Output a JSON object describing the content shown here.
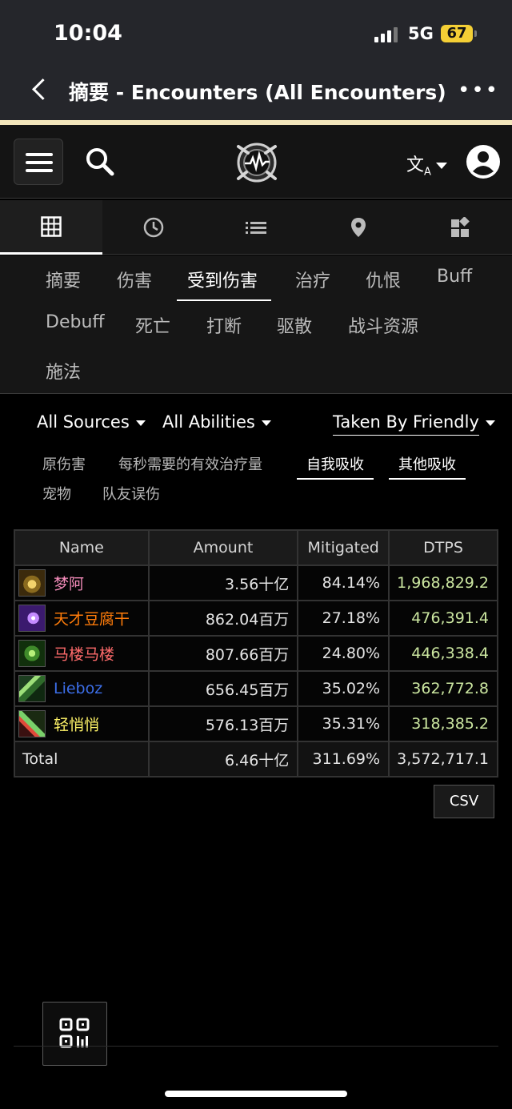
{
  "status_bar": {
    "time": "10:04",
    "network": "5G",
    "battery": "67"
  },
  "browser": {
    "title": "摘要 - Encounters (All Encounters) -..."
  },
  "header": {
    "menu_icon": "hamburger-icon",
    "search_icon": "search-icon",
    "logo_icon": "warcraftlogs-logo",
    "translate_icon": "translate-icon",
    "account_icon": "account-icon"
  },
  "icon_tabs": [
    "grid-icon",
    "clock-icon",
    "list-icon",
    "map-pin-icon",
    "widgets-icon"
  ],
  "sub_tabs": {
    "summary": "摘要",
    "damage": "伤害",
    "damage_taken": "受到伤害",
    "healing": "治疗",
    "threat": "仇恨",
    "buff": "Buff",
    "debuff": "Debuff",
    "deaths": "死亡",
    "interrupts": "打断",
    "dispels": "驱散",
    "resources": "战斗资源",
    "casts": "施法"
  },
  "filters": {
    "sources": "All Sources",
    "abilities": "All Abilities",
    "target": "Taken By Friendly"
  },
  "options": {
    "raw_damage": "原伤害",
    "ehps": "每秒需要的有效治疗量",
    "self_absorb": "自我吸收",
    "other_absorb": "其他吸收",
    "pets": "宠物",
    "friendly_fire": "队友误伤"
  },
  "table": {
    "headers": {
      "name": "Name",
      "amount": "Amount",
      "mitigated": "Mitigated",
      "dtps": "DTPS"
    },
    "rows": [
      {
        "name": "梦阿",
        "amount": "3.56十亿",
        "mitigated": "84.14%",
        "dtps": "1,968,829.2",
        "color": "#f48cba",
        "icon": "paladin-spec-icon"
      },
      {
        "name": "天才豆腐干",
        "amount": "862.04百万",
        "mitigated": "27.18%",
        "dtps": "476,391.4",
        "color": "#ff7c0a",
        "icon": "shadow-spec-icon"
      },
      {
        "name": "马楼马楼",
        "amount": "807.66百万",
        "mitigated": "24.80%",
        "dtps": "446,338.4",
        "color": "#ff6b6b",
        "icon": "warlock-spec-icon"
      },
      {
        "name": "Lieboz",
        "amount": "656.45百万",
        "mitigated": "35.02%",
        "dtps": "362,772.8",
        "color": "#3c6ee8",
        "icon": "shaman-spec-icon"
      },
      {
        "name": "轻悄悄",
        "amount": "576.13百万",
        "mitigated": "35.31%",
        "dtps": "318,385.2",
        "color": "#fff468",
        "icon": "rogue-spec-icon"
      }
    ],
    "total": {
      "label": "Total",
      "amount": "6.46十亿",
      "mitigated": "311.69%",
      "dtps": "3,572,717.1"
    }
  },
  "csv_label": "CSV",
  "qr_icon": "qr-code-icon"
}
